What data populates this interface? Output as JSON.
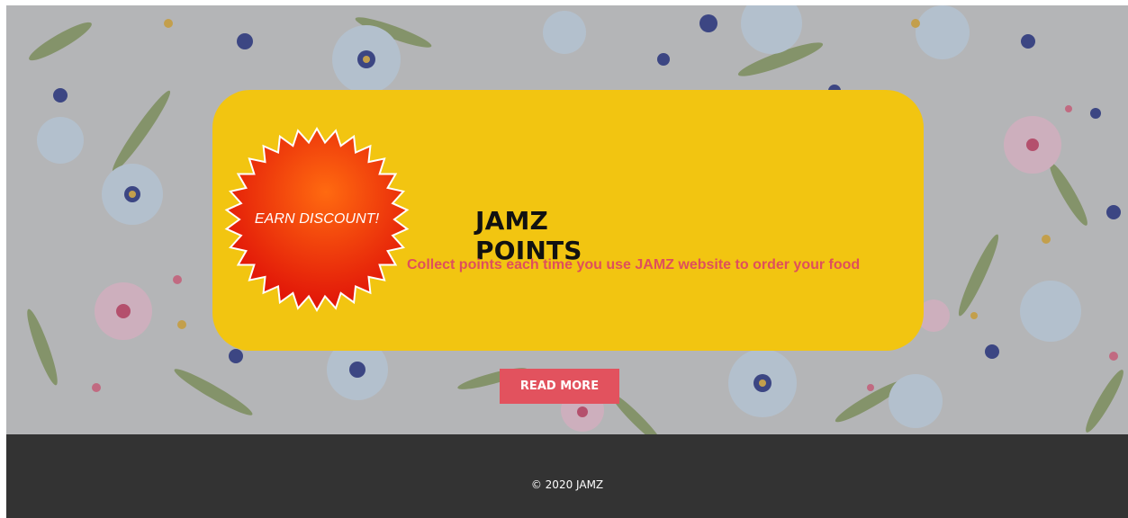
{
  "promo": {
    "badge_text": "EARN DISCOUNT!",
    "title": "JAMZ POINTS",
    "subtitle": "Collect points each time you use JAMZ website to order your food"
  },
  "cta": {
    "label": "READ MORE"
  },
  "footer": {
    "copyright": "© 2020 JAMZ"
  },
  "colors": {
    "card": "#f2c511",
    "accent": "#df4f5c",
    "button": "#e2525e",
    "footer": "#333333",
    "badge": "#e81a0a"
  }
}
